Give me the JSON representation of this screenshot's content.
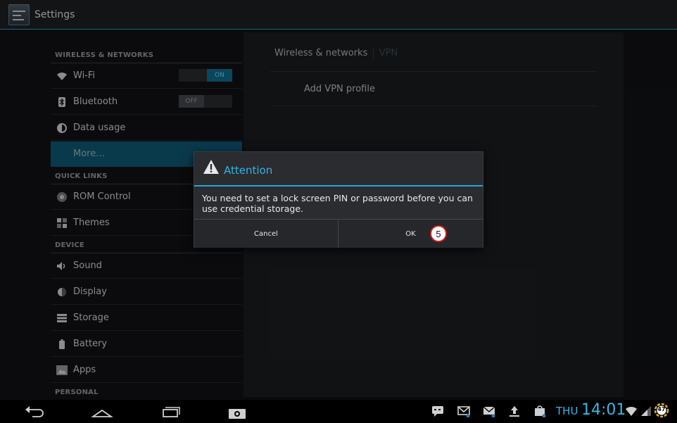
{
  "action_bar": {
    "title": "Settings",
    "icon": "settings-app-icon"
  },
  "sections": {
    "wireless": "WIRELESS & NETWORKS",
    "quick_links": "QUICK LINKS",
    "device": "DEVICE",
    "personal": "PERSONAL"
  },
  "items": {
    "wifi": {
      "label": "Wi-Fi",
      "icon": "wifi-icon",
      "toggle": "ON"
    },
    "bluetooth": {
      "label": "Bluetooth",
      "icon": "bluetooth-icon",
      "toggle": "OFF"
    },
    "data_usage": {
      "label": "Data usage",
      "icon": "data-usage-icon"
    },
    "more": {
      "label": "More…"
    },
    "rom_control": {
      "label": "ROM Control",
      "icon": "rom-control-icon"
    },
    "themes": {
      "label": "Themes",
      "icon": "themes-icon"
    },
    "sound": {
      "label": "Sound",
      "icon": "sound-icon"
    },
    "display": {
      "label": "Display",
      "icon": "display-icon"
    },
    "storage": {
      "label": "Storage",
      "icon": "storage-icon"
    },
    "battery": {
      "label": "Battery",
      "icon": "battery-icon"
    },
    "apps": {
      "label": "Apps",
      "icon": "apps-icon"
    }
  },
  "right_pane": {
    "breadcrumb_main": "Wireless & networks",
    "breadcrumb_sub": "VPN",
    "add_vpn": "Add VPN profile"
  },
  "dialog": {
    "title": "Attention",
    "message": "You need to set a lock screen PIN or password before you can use credential storage.",
    "cancel": "Cancel",
    "ok": "OK",
    "step_badge": "5"
  },
  "system_bar": {
    "day": "THU",
    "time": "14:01",
    "battery_level": "47",
    "colors": {
      "accent": "#38b5e8"
    }
  }
}
